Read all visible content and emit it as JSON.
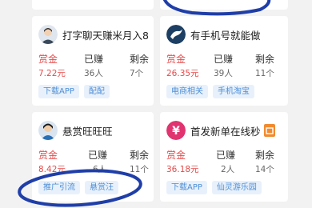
{
  "cards": [
    {
      "title": "打字聊天赚米月入8...",
      "avatar_icon": "person-avatar",
      "reward_label": "赏金",
      "reward_value": "7.22元",
      "earned_label": "已赚",
      "earned_value": "36人",
      "remain_label": "剩余",
      "remain_value": "7个",
      "tags": [
        "下载APP",
        "配配"
      ]
    },
    {
      "title": "有手机号就能做",
      "avatar_icon": "bird-logo-avatar",
      "reward_label": "赏金",
      "reward_value": "26.35元",
      "earned_label": "已赚",
      "earned_value": "39人",
      "remain_label": "剩余",
      "remain_value": "11个",
      "tags": [
        "电商相关",
        "手机淘宝"
      ]
    },
    {
      "title": "悬赏旺旺旺",
      "avatar_icon": "person-avatar",
      "reward_label": "赏金",
      "reward_value": "8.42元",
      "earned_label": "已赚",
      "earned_value": "6人",
      "remain_label": "剩余",
      "remain_value": "11个",
      "tags": [
        "推广引流",
        "悬赏汪"
      ]
    },
    {
      "title": "首发新单在线秒",
      "avatar_icon": "yen-avatar",
      "badge": "",
      "reward_label": "赏金",
      "reward_value": "36.18元",
      "earned_label": "已赚",
      "earned_value": "2人",
      "remain_label": "剩余",
      "remain_value": "14个",
      "tags": [
        "下载APP",
        "仙灵游乐园"
      ]
    }
  ],
  "colors": {
    "accent_red": "#e54b4b",
    "tag_blue": "#4d8ed6",
    "annotation_ink": "#1f3ea8"
  }
}
